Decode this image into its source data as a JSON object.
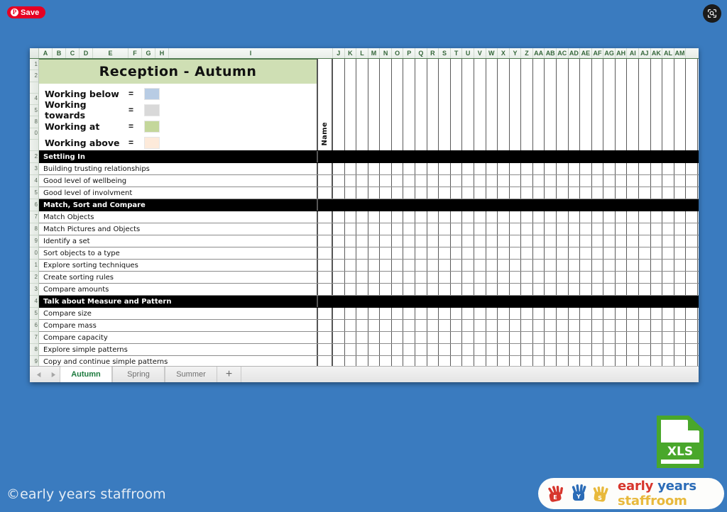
{
  "page": {
    "background_color": "#3a7bbf",
    "copyright": "©early years staffroom"
  },
  "pinterest": {
    "label": "Save",
    "glyph": "P",
    "color": "#e60023",
    "icon": "pinterest-icon"
  },
  "zoom_button": {
    "icon": "zoom-scan-icon",
    "color": "#1b1b1b"
  },
  "spreadsheet": {
    "title": "Reception  - Autumn",
    "title_bg": "#cfdfb4",
    "name_column_label": "Name",
    "column_headers": [
      "A",
      "B",
      "C",
      "D",
      "E",
      "F",
      "G",
      "H",
      "I",
      "J",
      "K",
      "L",
      "M",
      "N",
      "O",
      "P",
      "Q",
      "R",
      "S",
      "T",
      "U",
      "V",
      "W",
      "X",
      "Y",
      "Z",
      "AA",
      "AB",
      "AC",
      "AD",
      "AE",
      "AF",
      "AG",
      "AH",
      "AI",
      "AJ",
      "AK",
      "AL",
      "AM"
    ],
    "legend": [
      {
        "label": "Working below",
        "equals": "=",
        "color": "#b8cce4"
      },
      {
        "label": "Working towards",
        "equals": "=",
        "color": "#d9d9d9"
      },
      {
        "label": "Working at",
        "equals": "=",
        "color": "#c4d79b"
      },
      {
        "label": "Working above",
        "equals": "=",
        "color": "#fdeada"
      }
    ],
    "top_row_numbers": [
      "1",
      "2",
      "",
      "4",
      "5",
      "8",
      "0",
      ""
    ],
    "rows": [
      {
        "num": "2",
        "label": "Settling In",
        "section": true
      },
      {
        "num": "3",
        "label": "Building trusting relationships",
        "section": false
      },
      {
        "num": "4",
        "label": "Good level of wellbeing",
        "section": false
      },
      {
        "num": "5",
        "label": "Good level of involvment",
        "section": false
      },
      {
        "num": "6",
        "label": "Match, Sort and Compare",
        "section": true
      },
      {
        "num": "7",
        "label": "Match Objects",
        "section": false
      },
      {
        "num": "8",
        "label": "Match Pictures and Objects",
        "section": false
      },
      {
        "num": "9",
        "label": "Identify a set",
        "section": false
      },
      {
        "num": "0",
        "label": "Sort objects to a type",
        "section": false
      },
      {
        "num": "1",
        "label": "Explore sorting techniques",
        "section": false
      },
      {
        "num": "2",
        "label": "Create sorting rules",
        "section": false
      },
      {
        "num": "3",
        "label": "Compare amounts",
        "section": false
      },
      {
        "num": "4",
        "label": "Talk about Measure and Pattern",
        "section": true
      },
      {
        "num": "5",
        "label": "Compare size",
        "section": false
      },
      {
        "num": "6",
        "label": "Compare mass",
        "section": false
      },
      {
        "num": "7",
        "label": "Compare capacity",
        "section": false
      },
      {
        "num": "8",
        "label": "Explore simple patterns",
        "section": false
      },
      {
        "num": "9",
        "label": "Copy and continue simple patterns",
        "section": false
      }
    ],
    "tabs": [
      {
        "label": "Autumn",
        "active": true
      },
      {
        "label": "Spring",
        "active": false
      },
      {
        "label": "Summer",
        "active": false
      }
    ],
    "add_tab_label": "+",
    "nav_prev_icon": "triangle-left-icon",
    "nav_next_icon": "triangle-right-icon",
    "active_tab_color": "#1c7a3d"
  },
  "file_icon": {
    "label": "XLS",
    "color": "#49a72b",
    "name": "xls-file-icon"
  },
  "brand": {
    "word_early": "early",
    "word_years": "years",
    "word_staffroom": "staffroom",
    "color_early": "#d7352c",
    "color_years": "#2b6cb7",
    "color_staffroom": "#e8b93c",
    "hands": [
      {
        "letter": "E",
        "color": "#d7352c"
      },
      {
        "letter": "Y",
        "color": "#2b6cb7"
      },
      {
        "letter": "S",
        "color": "#e8b93c"
      }
    ]
  }
}
